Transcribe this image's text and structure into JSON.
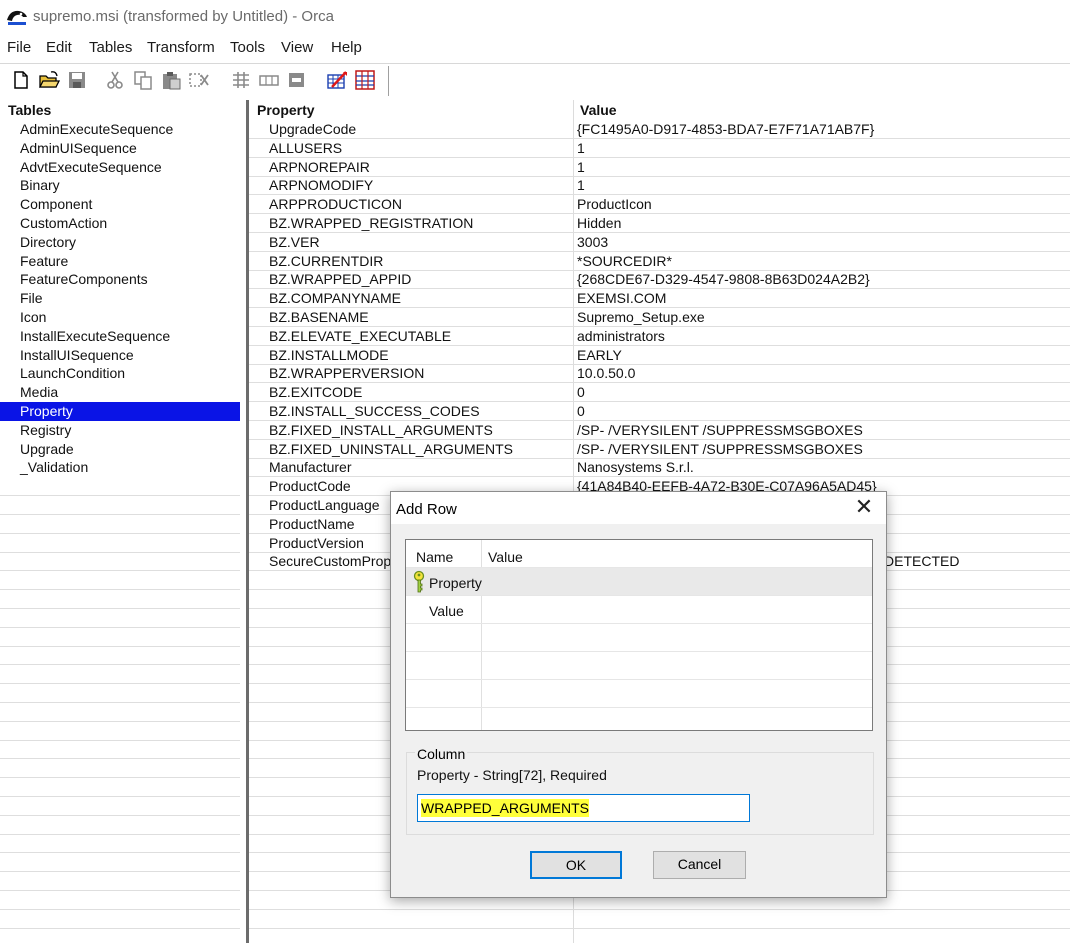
{
  "window": {
    "title": "supremo.msi (transformed by Untitled) - Orca"
  },
  "menu": [
    "File",
    "Edit",
    "Tables",
    "Transform",
    "Tools",
    "View",
    "Help"
  ],
  "toolbar_icons": [
    "new-file-icon",
    "open-folder-icon",
    "save-icon",
    "cut-icon",
    "copy-icon",
    "paste-icon",
    "delete-icon",
    "add-table-icon",
    "add-row-icon",
    "drop-table-icon",
    "validate-icon",
    "tables-grid-icon"
  ],
  "tables_pane": {
    "header": "Tables",
    "items": [
      "AdminExecuteSequence",
      "AdminUISequence",
      "AdvtExecuteSequence",
      "Binary",
      "Component",
      "CustomAction",
      "Directory",
      "Feature",
      "FeatureComponents",
      "File",
      "Icon",
      "InstallExecuteSequence",
      "InstallUISequence",
      "LaunchCondition",
      "Media",
      "Property",
      "Registry",
      "Upgrade",
      "_Validation"
    ],
    "selected": "Property"
  },
  "property_table": {
    "columns": [
      "Property",
      "Value"
    ],
    "rows": [
      [
        "UpgradeCode",
        "{FC1495A0-D917-4853-BDA7-E7F71A71AB7F}"
      ],
      [
        "ALLUSERS",
        "1"
      ],
      [
        "ARPNOREPAIR",
        "1"
      ],
      [
        "ARPNOMODIFY",
        "1"
      ],
      [
        "ARPPRODUCTICON",
        "ProductIcon"
      ],
      [
        "BZ.WRAPPED_REGISTRATION",
        "Hidden"
      ],
      [
        "BZ.VER",
        "3003"
      ],
      [
        "BZ.CURRENTDIR",
        "*SOURCEDIR*"
      ],
      [
        "BZ.WRAPPED_APPID",
        "{268CDE67-D329-4547-9808-8B63D024A2B2}"
      ],
      [
        "BZ.COMPANYNAME",
        "EXEMSI.COM"
      ],
      [
        "BZ.BASENAME",
        "Supremo_Setup.exe"
      ],
      [
        "BZ.ELEVATE_EXECUTABLE",
        "administrators"
      ],
      [
        "BZ.INSTALLMODE",
        "EARLY"
      ],
      [
        "BZ.WRAPPERVERSION",
        "10.0.50.0"
      ],
      [
        "BZ.EXITCODE",
        "0"
      ],
      [
        "BZ.INSTALL_SUCCESS_CODES",
        "0"
      ],
      [
        "BZ.FIXED_INSTALL_ARGUMENTS",
        "/SP- /VERYSILENT /SUPPRESSMSGBOXES"
      ],
      [
        "BZ.FIXED_UNINSTALL_ARGUMENTS",
        "/SP- /VERYSILENT /SUPPRESSMSGBOXES"
      ],
      [
        "Manufacturer",
        "Nanosystems S.r.l."
      ],
      [
        "ProductCode",
        "{41A84B40-EEFB-4A72-B30E-C07A96A5AD45}"
      ],
      [
        "ProductLanguage",
        ""
      ],
      [
        "ProductName",
        ""
      ],
      [
        "ProductVersion",
        ""
      ],
      [
        "SecureCustomProp",
        "DETECTED"
      ]
    ]
  },
  "dialog": {
    "title": "Add Row",
    "close_glyph": "✕",
    "grid_headers": [
      "Name",
      "Value"
    ],
    "grid_rows": [
      {
        "name": "Property",
        "value": ""
      },
      {
        "name": "Value",
        "value": ""
      }
    ],
    "group_label": "Column",
    "column_description": "Property - String[72], Required",
    "input_value": "WRAPPED_ARGUMENTS",
    "ok_label": "OK",
    "cancel_label": "Cancel"
  }
}
